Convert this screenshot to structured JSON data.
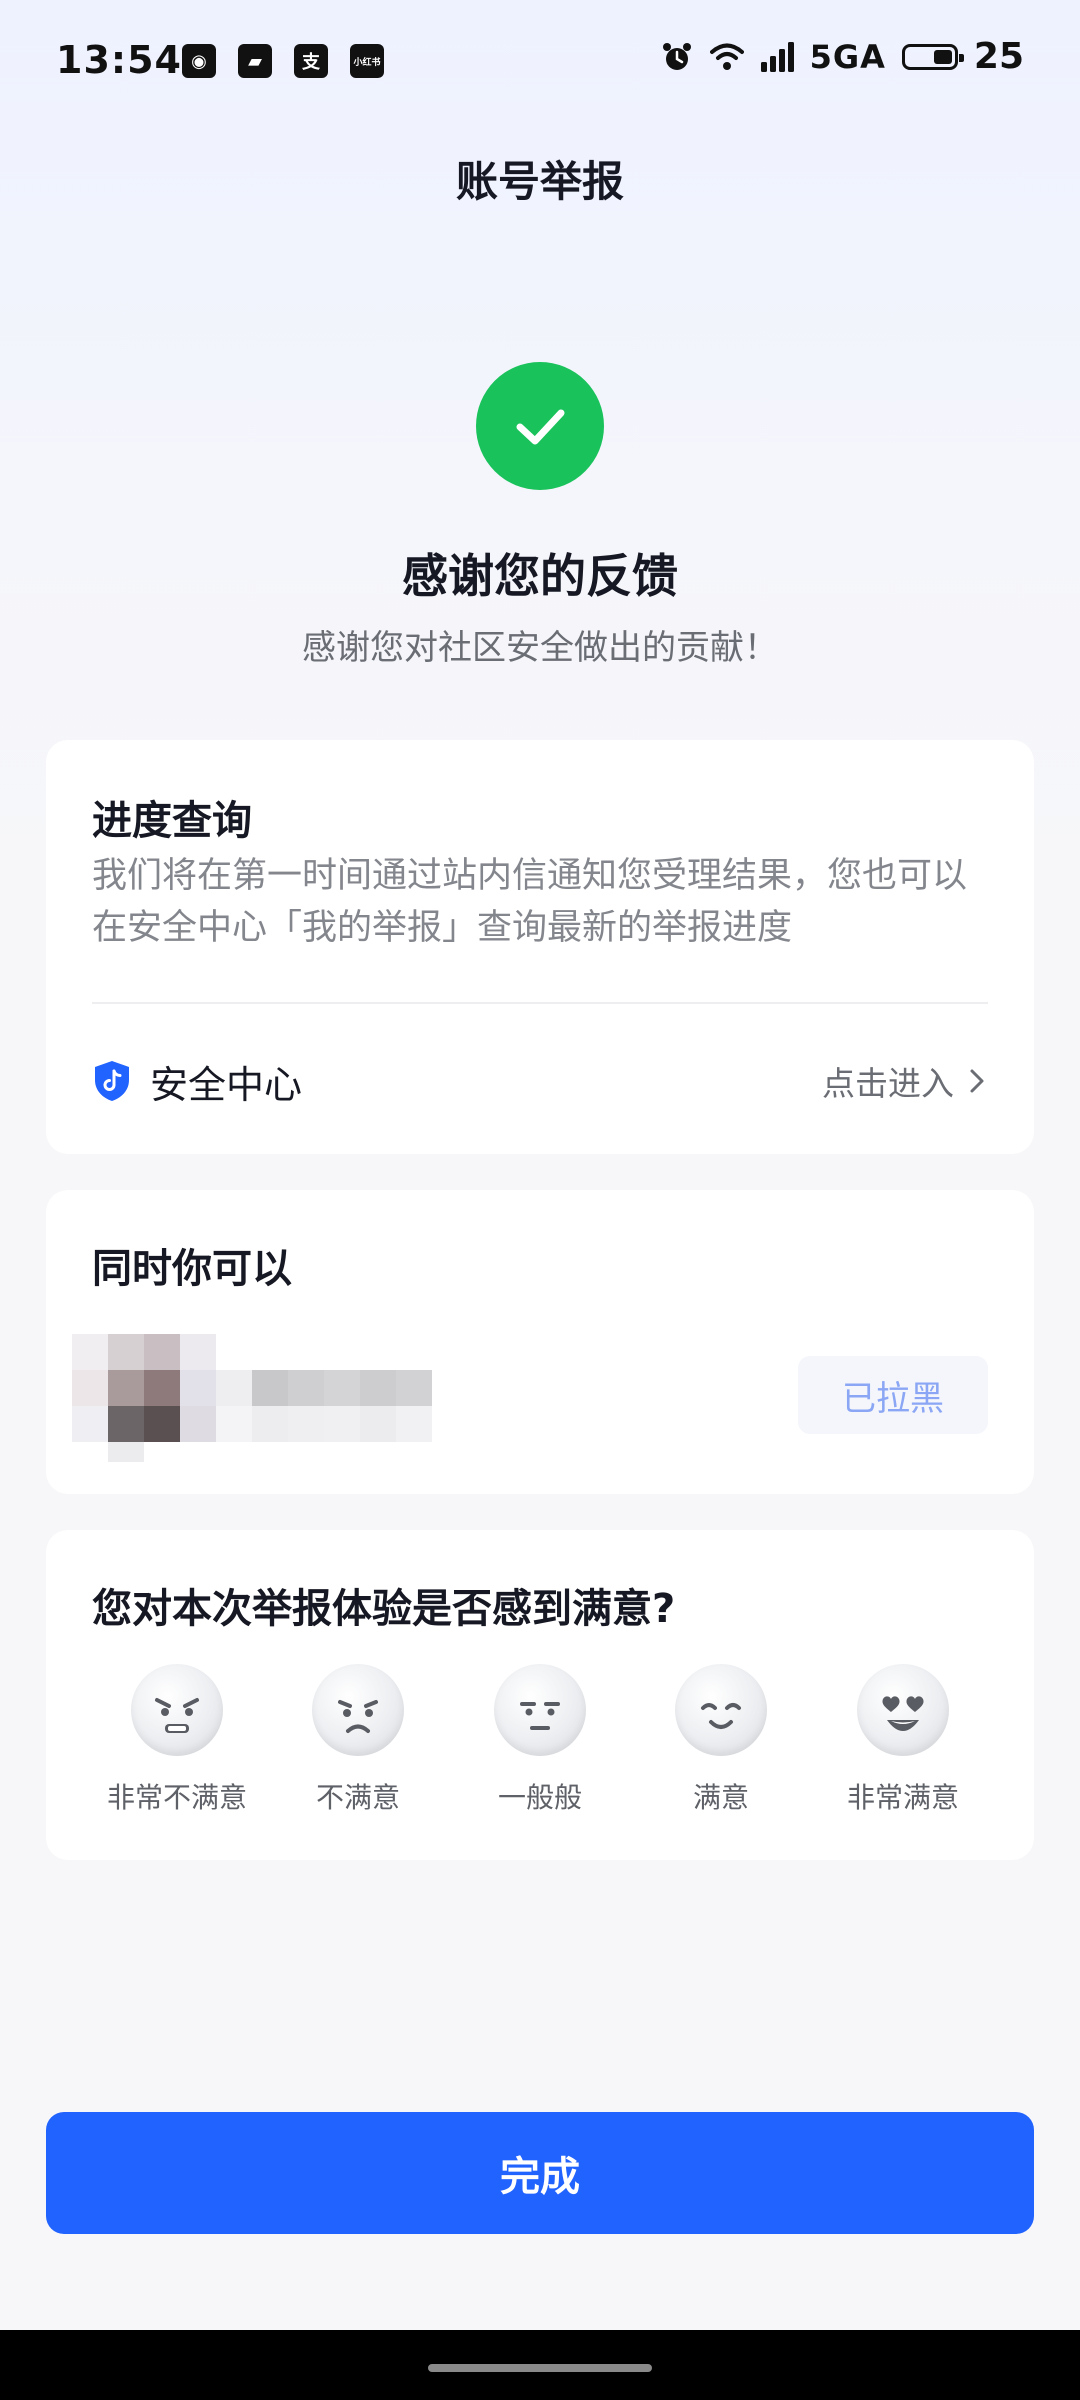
{
  "status_bar": {
    "time": "13:54",
    "left_icons": [
      "weibo-icon",
      "gallery-icon",
      "alipay-icon",
      "xiaohongshu-icon"
    ],
    "mini_label": "小红书",
    "network": "5GA",
    "battery": "25"
  },
  "nav": {
    "title": "账号举报"
  },
  "success": {
    "title": "感谢您的反馈",
    "subtitle": "感谢您对社区安全做出的贡献！",
    "color": "#19c25a"
  },
  "progress_card": {
    "title": "进度查询",
    "description": "我们将在第一时间通过站内信通知您受理结果，您也可以在安全中心「我的举报」查询最新的举报进度",
    "security_center_label": "安全中心",
    "enter_label": "点击进入"
  },
  "also_card": {
    "title": "同时你可以",
    "blocked_label": "已拉黑"
  },
  "rating_card": {
    "title": "您对本次举报体验是否感到满意?",
    "options": [
      {
        "label": "非常不满意"
      },
      {
        "label": "不满意"
      },
      {
        "label": "一般般"
      },
      {
        "label": "满意"
      },
      {
        "label": "非常满意"
      }
    ]
  },
  "footer": {
    "done_label": "完成",
    "accent_color": "#2163ff"
  }
}
